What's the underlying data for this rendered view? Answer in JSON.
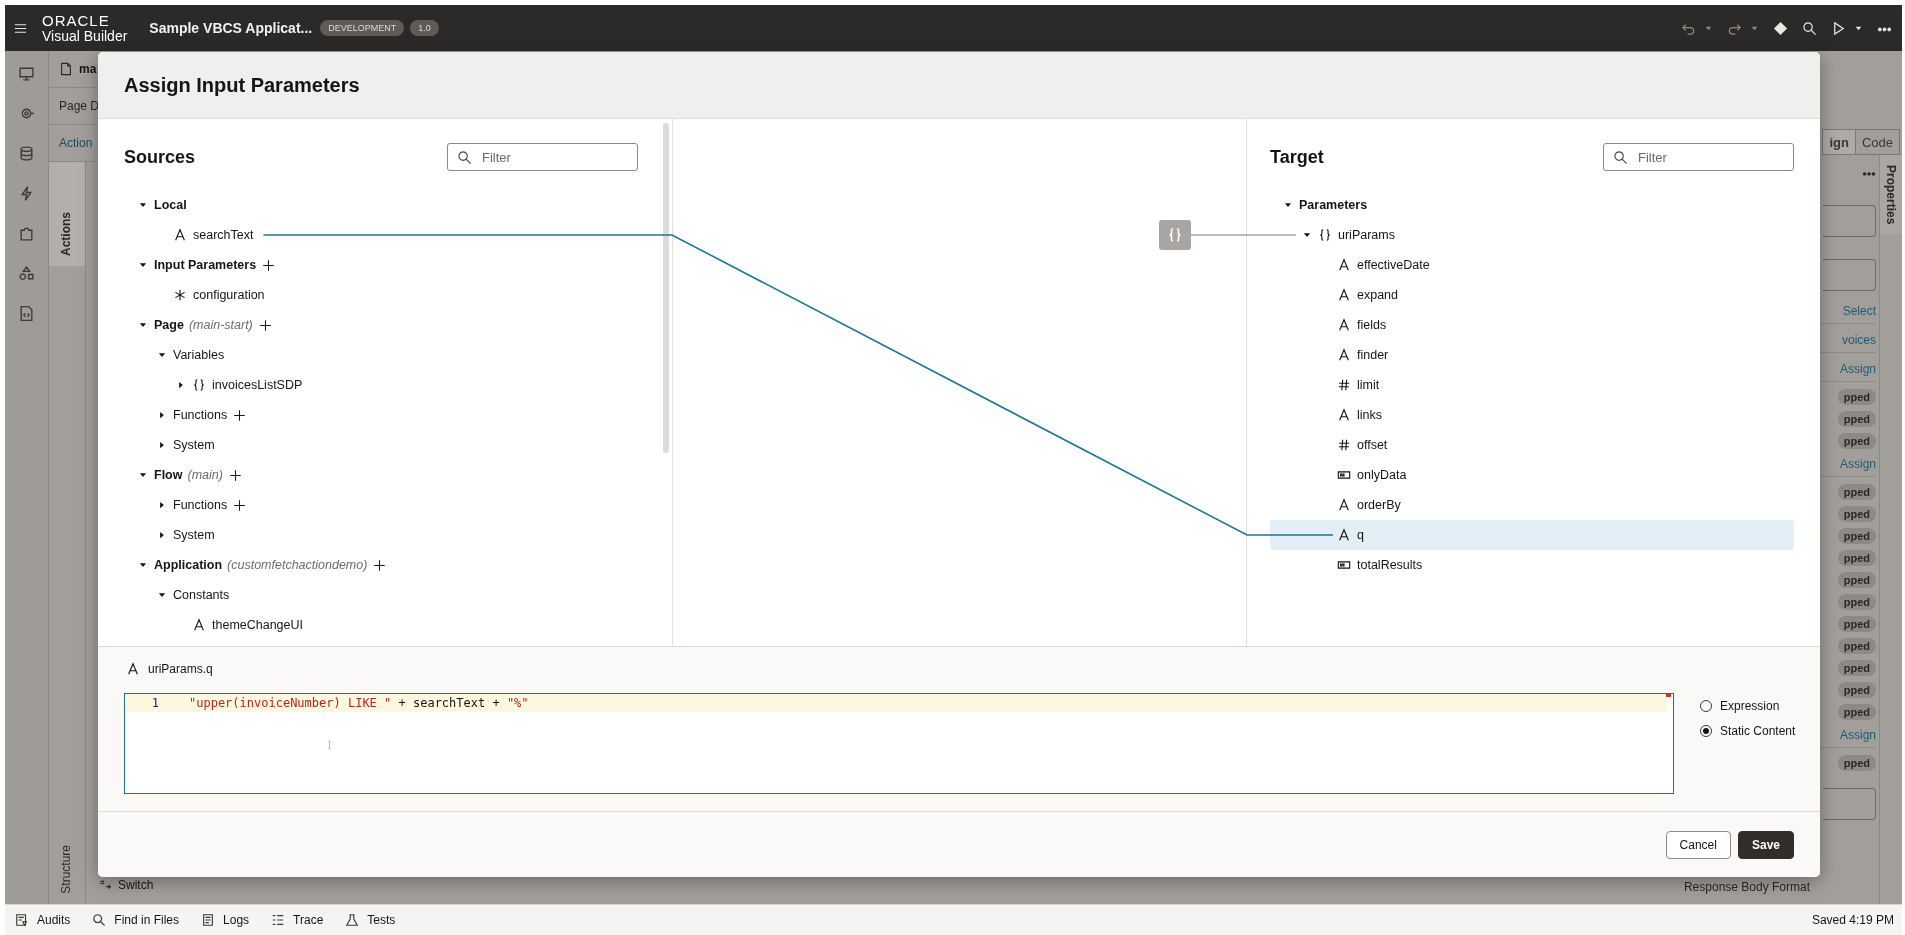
{
  "app_bar": {
    "brand_top": "ORACLE",
    "brand_bottom": "Visual Builder",
    "app_name": "Sample VBCS Applicat...",
    "badges": [
      "DEVELOPMENT",
      "1.0"
    ]
  },
  "backdrop": {
    "file_tab": "ma",
    "page_tab": "Page D",
    "action_tab": "Action",
    "vertical_tabs": [
      {
        "label": "Actions",
        "selected": true
      },
      {
        "label": "Structure",
        "selected": false
      }
    ],
    "switch_item": "Switch",
    "right_tabs": [
      {
        "label": "ign",
        "selected": true
      },
      {
        "label": "Code",
        "selected": false
      }
    ],
    "right_items": [
      {
        "kind": "more"
      },
      {
        "kind": "field"
      },
      {
        "kind": "field"
      },
      {
        "kind": "link",
        "text": "Select"
      },
      {
        "kind": "link",
        "text": "voices"
      },
      {
        "kind": "link",
        "text": "Assign"
      },
      {
        "kind": "badge",
        "text": "pped"
      },
      {
        "kind": "badge",
        "text": "pped"
      },
      {
        "kind": "badge",
        "text": "pped"
      },
      {
        "kind": "link",
        "text": "Assign"
      },
      {
        "kind": "badge",
        "text": "pped"
      },
      {
        "kind": "badge",
        "text": "pped"
      },
      {
        "kind": "badge",
        "text": "pped"
      },
      {
        "kind": "badge",
        "text": "pped"
      },
      {
        "kind": "badge",
        "text": "pped"
      },
      {
        "kind": "badge",
        "text": "pped"
      },
      {
        "kind": "badge",
        "text": "pped"
      },
      {
        "kind": "badge",
        "text": "pped"
      },
      {
        "kind": "badge",
        "text": "pped"
      },
      {
        "kind": "badge",
        "text": "pped"
      },
      {
        "kind": "badge",
        "text": "pped"
      },
      {
        "kind": "link",
        "text": "Assign"
      },
      {
        "kind": "badge",
        "text": "pped"
      },
      {
        "kind": "field"
      }
    ],
    "properties_tab": "Properties",
    "bottom_text": "Response Body Format"
  },
  "dialog": {
    "title": "Assign Input Parameters",
    "sources": {
      "title": "Sources",
      "filter_placeholder": "Filter",
      "tree": [
        {
          "label": "Local",
          "kind": "group",
          "expanded": true,
          "children": [
            {
              "label": "searchText",
              "kind": "string",
              "mapped": true
            }
          ]
        },
        {
          "label": "Input Parameters",
          "kind": "group",
          "expanded": true,
          "can_add": true,
          "children": [
            {
              "label": "configuration",
              "kind": "any"
            }
          ]
        },
        {
          "label": "Page",
          "note": "(main-start)",
          "kind": "group",
          "expanded": true,
          "can_add": true,
          "children": [
            {
              "label": "Variables",
              "expanded": true,
              "children": [
                {
                  "label": "invoicesListSDP",
                  "kind": "object",
                  "expanded": false
                }
              ]
            },
            {
              "label": "Functions",
              "expanded": false,
              "can_add": true
            },
            {
              "label": "System",
              "expanded": false
            }
          ]
        },
        {
          "label": "Flow",
          "note": "(main)",
          "kind": "group",
          "expanded": true,
          "can_add": true,
          "children": [
            {
              "label": "Functions",
              "expanded": false,
              "can_add": true
            },
            {
              "label": "System",
              "expanded": false
            }
          ]
        },
        {
          "label": "Application",
          "note": "(customfetchactiondemo)",
          "kind": "group",
          "expanded": true,
          "can_add": true,
          "children": [
            {
              "label": "Constants",
              "expanded": true,
              "children": [
                {
                  "label": "themeChangeUI",
                  "kind": "string"
                }
              ]
            }
          ]
        }
      ]
    },
    "target": {
      "title": "Target",
      "filter_placeholder": "Filter",
      "tree": [
        {
          "label": "Parameters",
          "kind": "group",
          "expanded": true,
          "selected": false,
          "children": [
            {
              "label": "uriParams",
              "kind": "object",
              "expanded": true,
              "linked": true,
              "selected": false,
              "children": [
                {
                  "label": "effectiveDate",
                  "kind": "string",
                  "selected": false
                },
                {
                  "label": "expand",
                  "kind": "string",
                  "selected": false
                },
                {
                  "label": "fields",
                  "kind": "string",
                  "selected": false
                },
                {
                  "label": "finder",
                  "kind": "string",
                  "selected": false
                },
                {
                  "label": "limit",
                  "kind": "number",
                  "selected": false
                },
                {
                  "label": "links",
                  "kind": "string",
                  "selected": false
                },
                {
                  "label": "offset",
                  "kind": "number",
                  "selected": false
                },
                {
                  "label": "onlyData",
                  "kind": "boolean",
                  "selected": false
                },
                {
                  "label": "orderBy",
                  "kind": "string",
                  "selected": false
                },
                {
                  "label": "q",
                  "kind": "string",
                  "selected": true,
                  "mapped": true
                },
                {
                  "label": "totalResults",
                  "kind": "boolean",
                  "selected": false
                }
              ]
            }
          ]
        }
      ]
    },
    "editor": {
      "label": "uriParams.q",
      "kind": "string",
      "line_number": "1",
      "tokens": [
        {
          "kind": "string",
          "text": "\"upper(invoiceNumber) LIKE \""
        },
        {
          "kind": "plain",
          "text": " + searchText + "
        },
        {
          "kind": "string",
          "text": "\"%\""
        }
      ]
    },
    "modes": [
      {
        "label": "Expression",
        "selected": false
      },
      {
        "label": "Static Content",
        "selected": true
      }
    ],
    "buttons": [
      {
        "label": "Cancel",
        "kind": "secondary"
      },
      {
        "label": "Save",
        "kind": "primary"
      }
    ]
  },
  "status_bar": {
    "items": [
      {
        "kind": "audits",
        "label": "Audits"
      },
      {
        "kind": "search",
        "label": "Find in Files"
      },
      {
        "kind": "logs",
        "label": "Logs"
      },
      {
        "kind": "trace",
        "label": "Trace"
      },
      {
        "kind": "tests",
        "label": "Tests"
      }
    ],
    "saved": "Saved 4:19 PM"
  }
}
